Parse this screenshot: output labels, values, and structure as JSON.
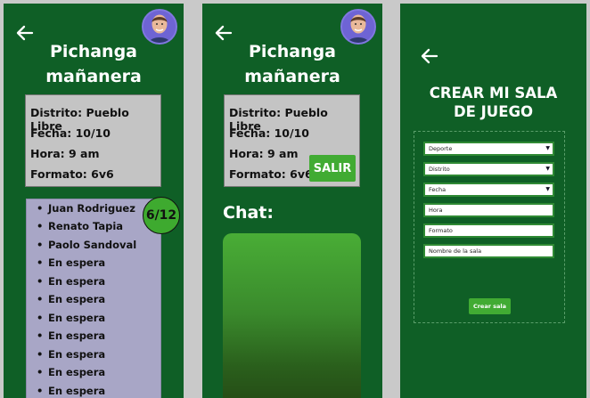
{
  "screen1": {
    "title_line1": "Pichanga",
    "title_line2": "mañanera",
    "info": {
      "distrito": "Distrito: Pueblo Libre",
      "fecha": "Fecha: 10/10",
      "hora": "Hora: 9 am",
      "formato": "Formato: 6v6"
    },
    "count": "6/12",
    "players": [
      "Juan Rodriguez",
      "Renato Tapia",
      "Paolo Sandoval",
      "En espera",
      "En espera",
      "En espera",
      "En espera",
      "En espera",
      "En espera",
      "En espera",
      "En espera"
    ]
  },
  "screen2": {
    "title_line1": "Pichanga",
    "title_line2": "mañanera",
    "info": {
      "distrito": "Distrito: Pueblo Libre",
      "fecha": "Fecha: 10/10",
      "hora": "Hora: 9 am",
      "formato": "Formato: 6v6"
    },
    "salir": "SALIR",
    "chat_label": "Chat:"
  },
  "screen3": {
    "title_line1": "CREAR MI SALA",
    "title_line2": "DE JUEGO",
    "fields": [
      "Deporte",
      "Distrito",
      "Fecha",
      "Hora",
      "Formato",
      "Nombre de la sala"
    ],
    "create_button": "Crear sala"
  },
  "icons": {
    "back": "arrow-left-icon",
    "avatar": "user-avatar",
    "dropdown": "triangle-down-icon"
  },
  "colors": {
    "background": "#0f5f26",
    "accent": "#41ab33",
    "info_box": "#c4c4c4",
    "players_box": "#a8a6c6"
  }
}
